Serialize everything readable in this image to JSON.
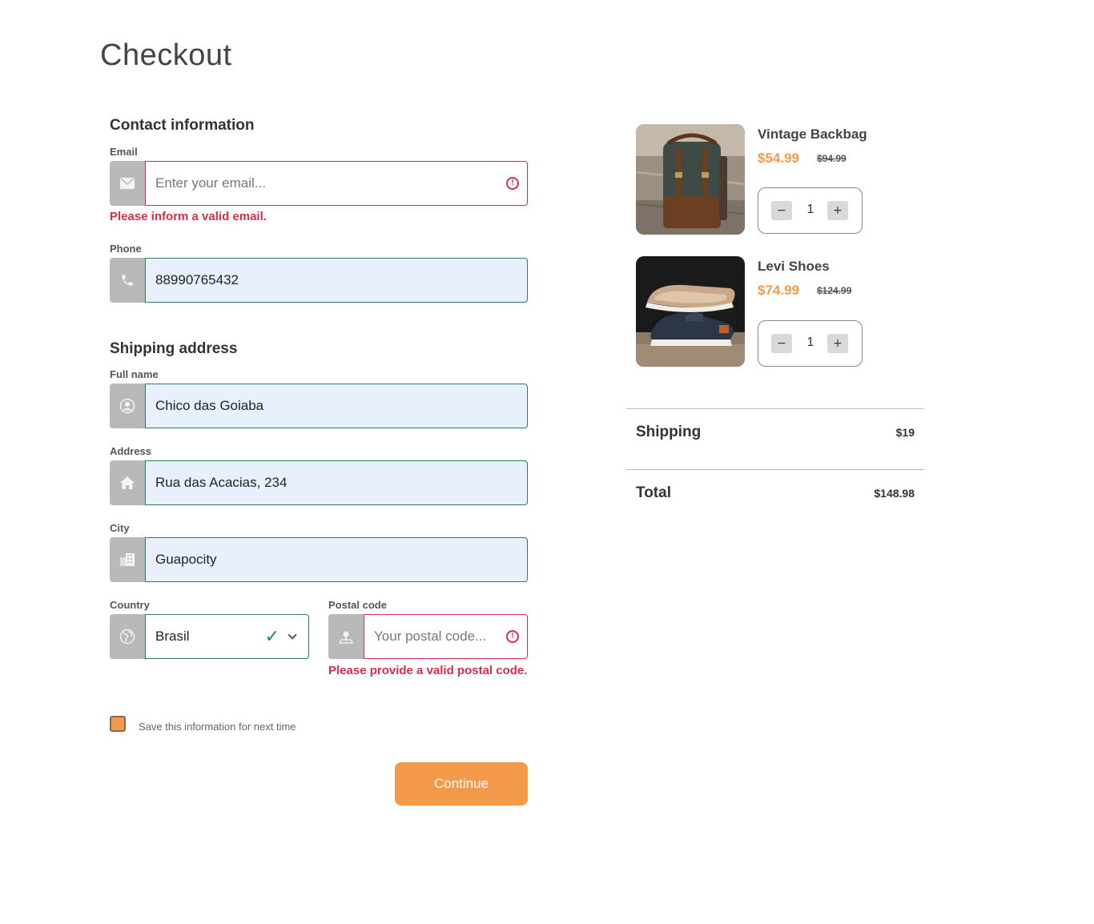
{
  "page": {
    "title": "Checkout"
  },
  "contact": {
    "title": "Contact information",
    "email": {
      "label": "Email",
      "value": "",
      "placeholder": "Enter your email...",
      "error": "Please inform a valid email."
    },
    "phone": {
      "label": "Phone",
      "value": "88990765432"
    }
  },
  "shipping": {
    "title": "Shipping address",
    "full_name": {
      "label": "Full name",
      "value": "Chico das Goiaba"
    },
    "address": {
      "label": "Address",
      "value": "Rua das Acacias, 234"
    },
    "city": {
      "label": "City",
      "value": "Guapocity"
    },
    "country": {
      "label": "Country",
      "selected": "Brasil"
    },
    "postal_code": {
      "label": "Postal code",
      "value": "",
      "placeholder": "Your postal code...",
      "error": "Please provide a valid postal code."
    }
  },
  "save_info": {
    "label": "Save this information for next time",
    "checked": true
  },
  "continue_label": "Continue",
  "cart": {
    "items": [
      {
        "name": "Vintage Backbag",
        "price": "$54.99",
        "old_price": "$94.99",
        "quantity": "1"
      },
      {
        "name": "Levi Shoes",
        "price": "$74.99",
        "old_price": "$124.99",
        "quantity": "1"
      }
    ],
    "qty_minus": "−",
    "qty_plus": "+"
  },
  "summary": {
    "shipping_label": "Shipping",
    "shipping_value": "$19",
    "total_label": "Total",
    "total_value": "$148.98"
  },
  "colors": {
    "accent": "#f39a4a",
    "error": "#d32f4a",
    "valid": "#2e7d5b",
    "autofill": "#e8f0fe"
  },
  "icons": {
    "email": "envelope-icon",
    "phone": "phone-icon",
    "full_name": "user-icon",
    "address": "home-icon",
    "city": "building-icon",
    "country": "globe-icon",
    "postal_code": "location-icon"
  }
}
